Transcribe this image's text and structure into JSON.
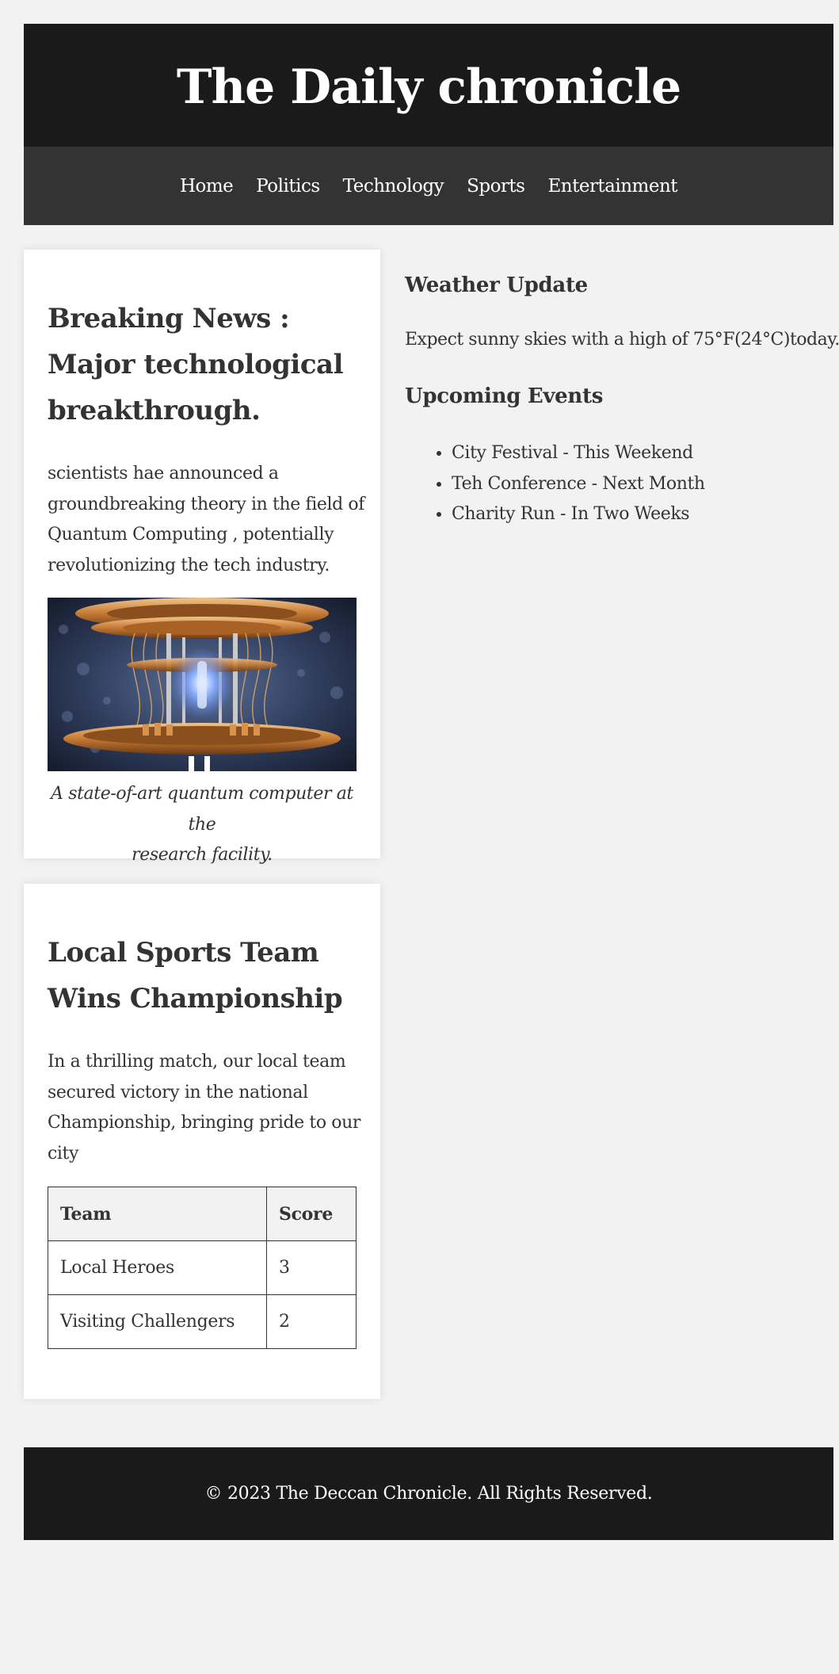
{
  "header": {
    "title": "The Daily chronicle"
  },
  "nav": {
    "items": [
      "Home",
      "Politics",
      "Technology",
      "Sports",
      "Entertainment"
    ]
  },
  "article1": {
    "title_lines": [
      "Breaking News :",
      "Major technological",
      "breakthrough."
    ],
    "body_lines": [
      "scientists hae announced a",
      "groundbreaking theory in the field of",
      "Quantum Computing , potentially",
      "revolutionizing the tech industry."
    ],
    "image_icon": "quantum-computer-image",
    "caption_lines": [
      "A state-of-art quantum computer at the",
      "research facility."
    ]
  },
  "article2": {
    "title_lines": [
      "Local Sports Team",
      "Wins Championship"
    ],
    "body_lines": [
      "In a thrilling match, our local team",
      "secured victory in the national",
      "Championship, bringing pride to our",
      "city"
    ],
    "table": {
      "headers": [
        "Team",
        "Score"
      ],
      "rows": [
        [
          "Local Heroes",
          "3"
        ],
        [
          "Visiting Challengers",
          "2"
        ]
      ]
    }
  },
  "sidebar": {
    "weather_title": "Weather Update",
    "weather_text": "Expect sunny skies with a high of 75°F(24°C)today.",
    "events_title": "Upcoming Events",
    "events": [
      "City Festival - This Weekend",
      "Teh Conference - Next Month",
      "Charity Run - In Two Weeks"
    ]
  },
  "footer": {
    "text": "© 2023 The Deccan Chronicle. All Rights Reserved."
  },
  "colors": {
    "page_bg": "#f2f2f2",
    "header_bg": "#1a1a1a",
    "nav_bg": "#333333",
    "text": "#333333",
    "caption": "#666666"
  }
}
